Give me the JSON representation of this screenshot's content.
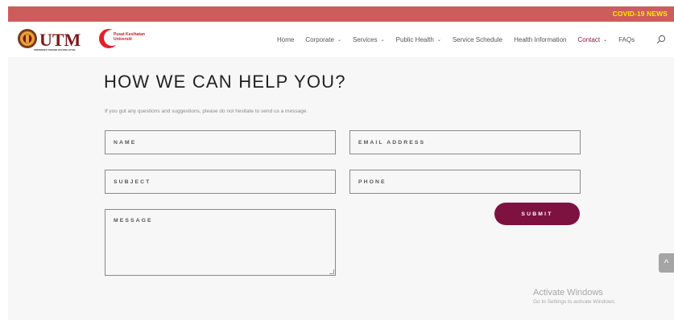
{
  "top_bar": {
    "link": "COVID-19 NEWS"
  },
  "logo": {
    "brand": "UTM",
    "tagline": "UNIVERSITI TEKNOLOGI MALAYSIA",
    "unit_line1": "Pusat Kesihatan",
    "unit_line2": "Universiti"
  },
  "nav": {
    "items": [
      {
        "label": "Home",
        "dropdown": false,
        "active": false
      },
      {
        "label": "Corporate",
        "dropdown": true,
        "active": false
      },
      {
        "label": "Services",
        "dropdown": true,
        "active": false
      },
      {
        "label": "Public Health",
        "dropdown": true,
        "active": false
      },
      {
        "label": "Service Schedule",
        "dropdown": false,
        "active": false
      },
      {
        "label": "Health Information",
        "dropdown": false,
        "active": false
      },
      {
        "label": "Contact",
        "dropdown": true,
        "active": true
      },
      {
        "label": "FAQs",
        "dropdown": false,
        "active": false
      }
    ]
  },
  "contact": {
    "title": "HOW WE CAN HELP YOU?",
    "intro": "If you got any questions and suggestions, please do not hesitate to send us a message.",
    "fields": {
      "name_placeholder": "NAME",
      "email_placeholder": "EMAIL ADDRESS",
      "subject_placeholder": "SUBJECT",
      "phone_placeholder": "PHONE",
      "message_placeholder": "MESSAGE"
    },
    "submit_label": "SUBMIT"
  },
  "scroll_top": {
    "glyph": "^"
  },
  "windows_watermark": {
    "title": "Activate Windows",
    "subtitle": "Go to Settings to activate Windows."
  },
  "colors": {
    "top_bar": "#cd5c5c",
    "top_bar_link": "#ffe600",
    "accent": "#7d1240",
    "active_nav": "#8b1a3a",
    "page_bg": "#f7f7f7"
  },
  "icons": [
    "search-icon",
    "chevron-down-icon",
    "chevron-up-icon",
    "utm-crest-icon",
    "crescent-icon"
  ]
}
